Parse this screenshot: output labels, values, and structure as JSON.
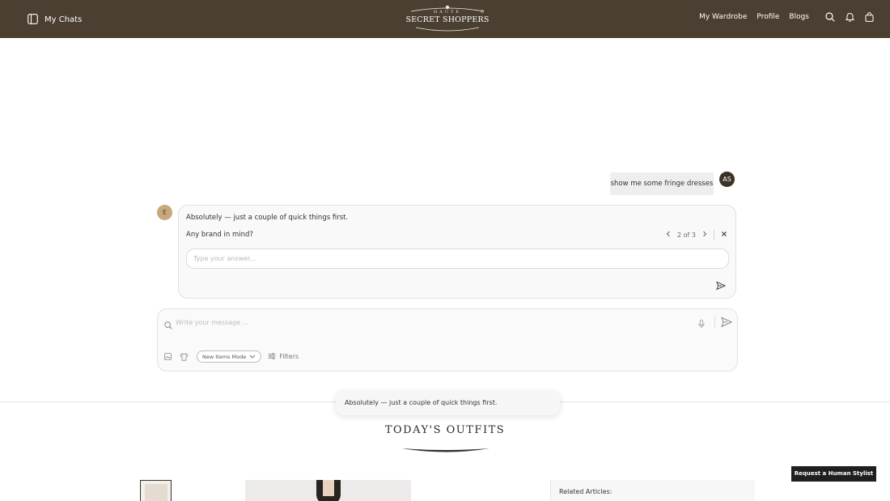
{
  "header": {
    "my_chats": "My Chats",
    "logo_top": "HAUTE",
    "logo_main": "SECRET SHOPPERS",
    "nav": [
      "My Wardrobe",
      "Profile",
      "Blogs"
    ],
    "bg_color": "#4a3f30",
    "icons": [
      "search-icon",
      "bell-icon",
      "bag-icon"
    ]
  },
  "chat": {
    "user_message": "show me some fringe dresses",
    "user_initials": "AS",
    "assistant_initial": "E",
    "assistant_intro": "Absolutely — just a couple of quick things first.",
    "question": "Any brand in mind?",
    "question_counter": "2 of 3",
    "answer_placeholder": "Type your answer..."
  },
  "composer": {
    "placeholder": "Write your message ...",
    "mode_label": "New Items Mode",
    "filters_label": "Filters"
  },
  "toast": "Absolutely — just a couple of quick things first.",
  "outfits": {
    "title": "TODAY'S OUTFITS",
    "request_stylist": "Request a Human Stylist",
    "related_articles": "Related Articles:"
  }
}
